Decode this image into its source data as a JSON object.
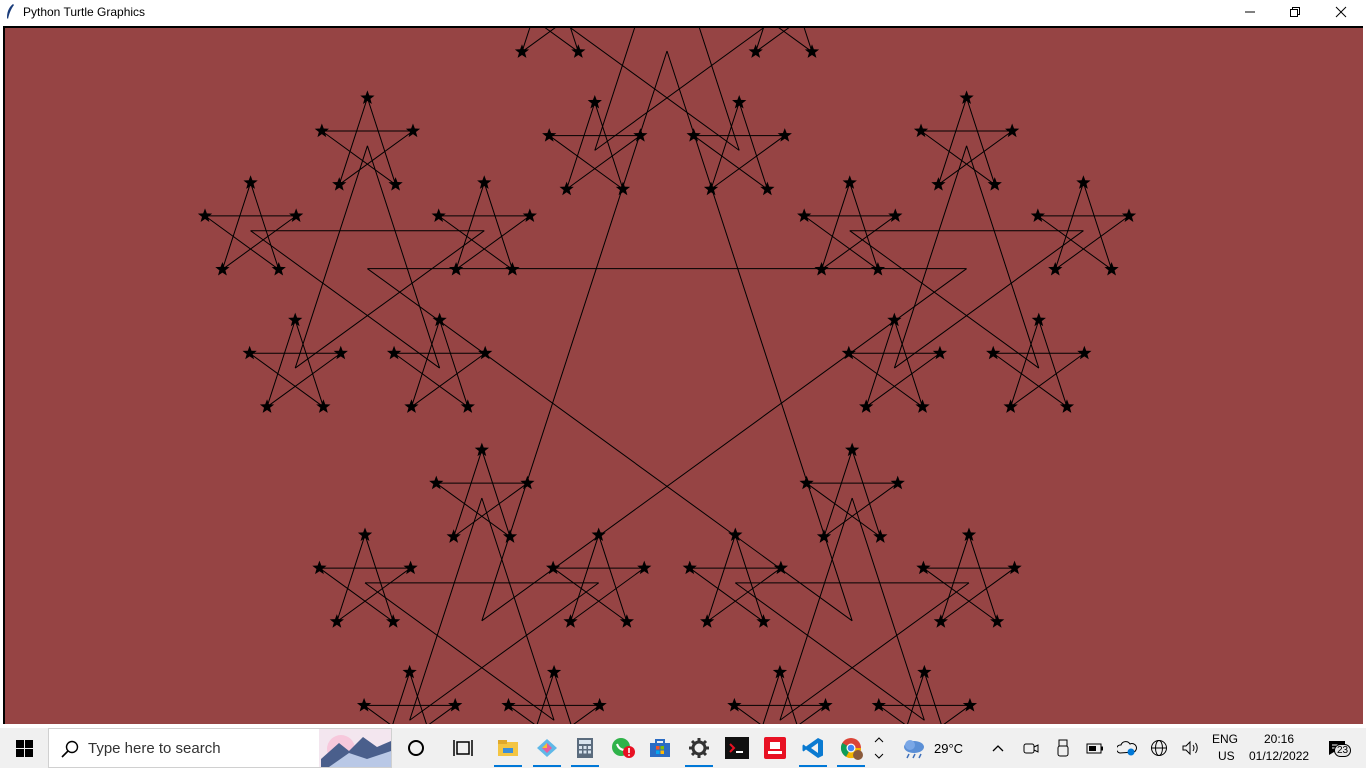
{
  "window": {
    "title": "Python Turtle Graphics",
    "controls": [
      "minimize-icon",
      "restore-icon",
      "close-icon"
    ]
  },
  "canvas": {
    "background": "#964444",
    "stroke_color": "#000000",
    "drawing": "nested pentagram fractal with star stamps"
  },
  "taskbar": {
    "search_placeholder": "Type here to search",
    "pinned_apps": [
      "cortana-icon",
      "task-view-icon",
      "file-explorer-icon",
      "git-icon",
      "calculator-icon",
      "whatsapp-icon",
      "microsoft-store-icon",
      "settings-icon",
      "terminal-icon",
      "anydesk-icon",
      "vscode-icon",
      "chrome-icon"
    ],
    "weather": {
      "temperature": "29°C",
      "icon": "cloud-rain-icon"
    },
    "tray_icons": [
      "chevron-up-icon",
      "meet-icon",
      "usb-icon",
      "battery-icon",
      "onedrive-icon",
      "network-icon",
      "volume-icon"
    ],
    "language": {
      "line1": "ENG",
      "line2": "US"
    },
    "clock": {
      "time": "20:16",
      "date": "01/12/2022"
    },
    "notifications": {
      "count": "23"
    },
    "accent_color": "#0078d7"
  }
}
